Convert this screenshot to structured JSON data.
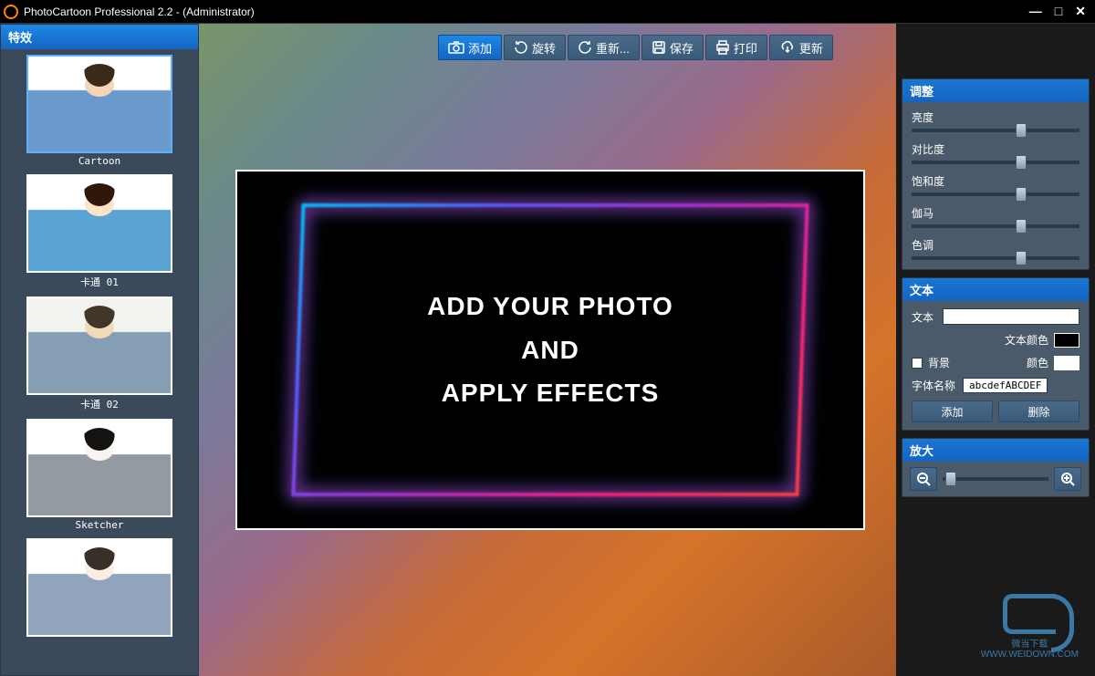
{
  "titlebar": {
    "text": "PhotoCartoon Professional 2.2 - (Administrator)"
  },
  "toolbar": {
    "add": "添加",
    "rotate": "旋转",
    "reload": "重新...",
    "save": "保存",
    "print": "打印",
    "update": "更新"
  },
  "sidebar": {
    "header": "特效",
    "effects": [
      {
        "label": "Cartoon"
      },
      {
        "label": "卡通 01"
      },
      {
        "label": "卡通 02"
      },
      {
        "label": "Sketcher"
      },
      {
        "label": ""
      }
    ]
  },
  "canvas": {
    "line1": "ADD YOUR PHOTO",
    "line2": "AND",
    "line3": "APPLY EFFECTS"
  },
  "adjust": {
    "header": "调整",
    "brightness": "亮度",
    "contrast": "对比度",
    "saturation": "饱和度",
    "gamma": "伽马",
    "hue": "色调"
  },
  "textpanel": {
    "header": "文本",
    "text_label": "文本",
    "text_value": "",
    "textcolor_label": "文本颜色",
    "textcolor_value": "#000000",
    "bg_label": "背景",
    "bgcolor_label": "颜色",
    "bgcolor_value": "#ffffff",
    "fontname_label": "字体名称",
    "fontsample": "abcdefABCDEF",
    "add_btn": "添加",
    "delete_btn": "删除"
  },
  "zoom": {
    "header": "放大"
  },
  "watermark": {
    "name": "微当下载",
    "url": "WWW.WEIDOWN.COM"
  }
}
